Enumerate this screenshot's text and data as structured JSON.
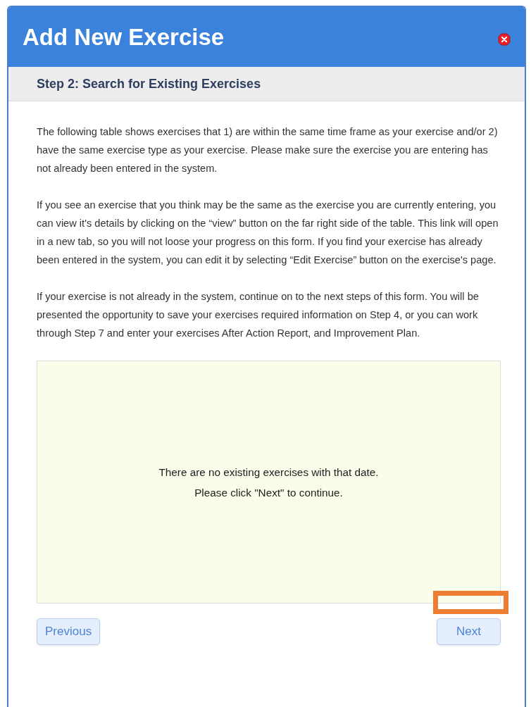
{
  "dialog": {
    "title": "Add New Exercise",
    "step_title": "Step 2: Search for Existing Exercises",
    "paragraphs": [
      "The following table shows exercises that 1) are within the same time frame as your exercise and/or 2) have the same exercise type as your exercise. Please make sure the exercise you are entering has not already been entered in the system.",
      "If you see an exercise that you think may be the same as the exercise you are currently entering, you can view it's details by clicking on the “view” button on the far right side of the table. This link will open in a new tab, so you will not loose your progress on this form. If you find your exercise has already been entered in the system, you can edit it by selecting “Edit Exercise” button on the exercise's page.",
      "If your exercise is not already in the system, continue on to the next steps of this form. You will be presented the opportunity to save your exercises required information on Step 4, or you can work through Step 7 and enter your exercises After Action Report, and Improvement Plan."
    ],
    "results_message": [
      "There are no existing exercises with that date.",
      "Please click \"Next\" to continue."
    ],
    "buttons": [
      {
        "label": "Previous"
      },
      {
        "label": "Next"
      }
    ]
  }
}
